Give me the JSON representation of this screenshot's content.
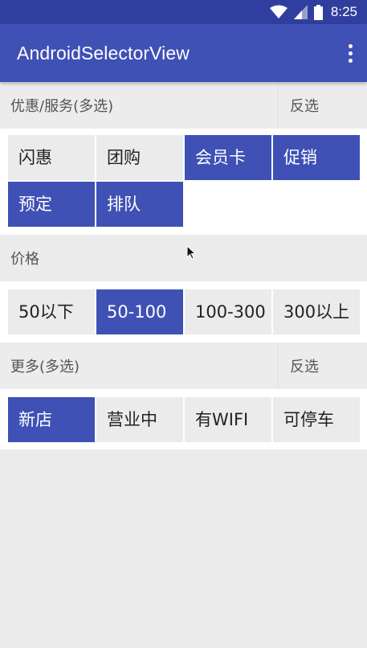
{
  "status_bar": {
    "time": "8:25",
    "icons": [
      "wifi-icon",
      "cellular-signal-icon",
      "battery-icon"
    ]
  },
  "app_bar": {
    "title": "AndroidSelectorView",
    "menu_icon": "more-vert-icon"
  },
  "colors": {
    "primary": "#3f51b5",
    "primary_dark": "#303f9f",
    "chip_unselected": "#ebebeb",
    "background": "#ececec"
  },
  "sections": [
    {
      "title": "优惠/服务(多选)",
      "action": "反选",
      "options": [
        {
          "label": "闪惠",
          "selected": false
        },
        {
          "label": "团购",
          "selected": false
        },
        {
          "label": "会员卡",
          "selected": true
        },
        {
          "label": "促销",
          "selected": true
        },
        {
          "label": "预定",
          "selected": true
        },
        {
          "label": "排队",
          "selected": true
        }
      ]
    },
    {
      "title": "价格",
      "options": [
        {
          "label": "50以下",
          "selected": false
        },
        {
          "label": "50-100",
          "selected": true
        },
        {
          "label": "100-300",
          "selected": false
        },
        {
          "label": "300以上",
          "selected": false
        }
      ]
    },
    {
      "title": "更多(多选)",
      "action": "反选",
      "options": [
        {
          "label": "新店",
          "selected": true
        },
        {
          "label": "营业中",
          "selected": false
        },
        {
          "label": "有WIFI",
          "selected": false
        },
        {
          "label": "可停车",
          "selected": false
        }
      ]
    }
  ]
}
